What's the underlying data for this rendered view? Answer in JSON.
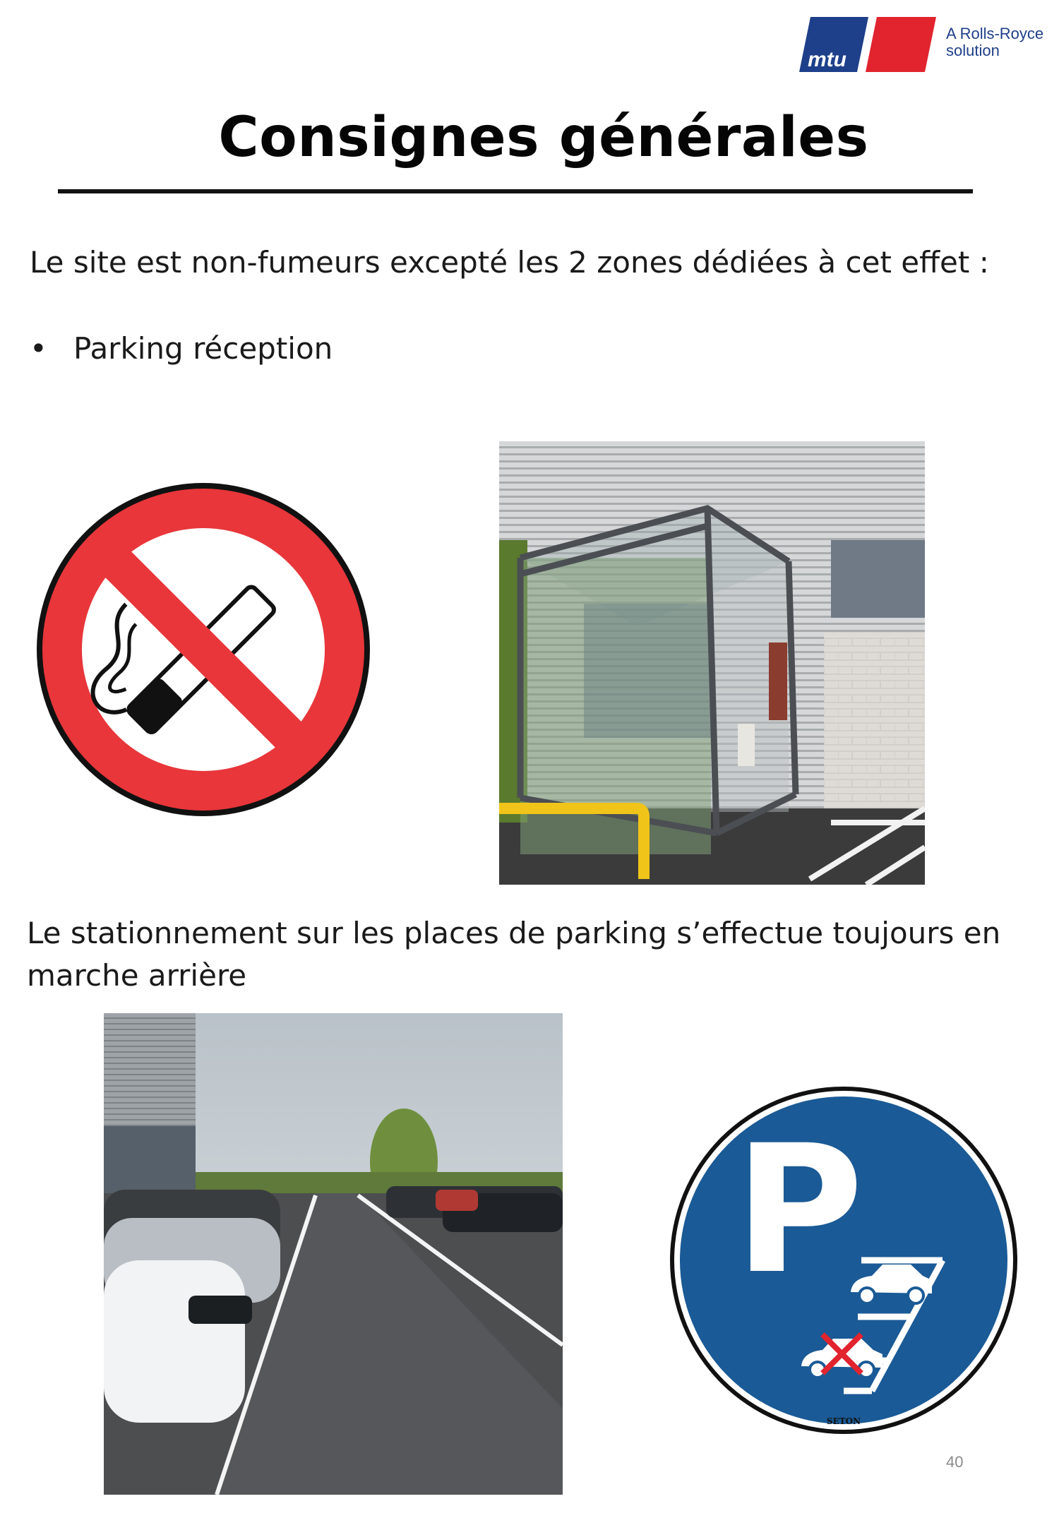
{
  "logo": {
    "brand": "mtu",
    "tagline_line1": "A Rolls-Royce",
    "tagline_line2": "solution",
    "colors": {
      "blue": "#1e3f8a",
      "red": "#e1242e"
    }
  },
  "title": "Consignes générales",
  "smoking": {
    "text": "Le site est non-fumeurs excepté les 2 zones dédiées à cet effet :",
    "bullet_symbol": "•",
    "bullets": [
      "Parking réception"
    ],
    "sign_icon": "no-smoking-sign",
    "photo": "smoking-shelter-photo"
  },
  "parking": {
    "text": "Le stationnement sur les places de parking s’effectue toujours en marche arrière",
    "photo": "parking-lot-photo",
    "sign_icon": "reverse-parking-sign",
    "sign_letter": "P",
    "sign_maker": "SETON",
    "sign_color": "#1a5a96"
  },
  "page_number": "40"
}
